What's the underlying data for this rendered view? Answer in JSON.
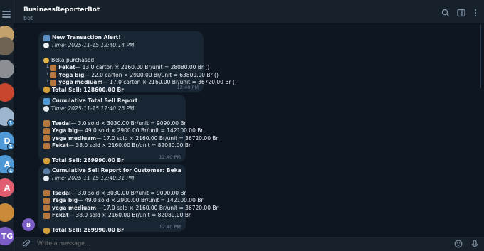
{
  "header": {
    "title": "BusinessReporterBot",
    "subtitle": "bot",
    "icons": [
      "search-icon",
      "sidebar-toggle-icon",
      "more-vert-icon"
    ]
  },
  "sidebar": {
    "chats": [
      {
        "initial": "",
        "color": "#c2a26a",
        "badge": ""
      },
      {
        "initial": "",
        "color": "#6e6252",
        "badge": ""
      },
      {
        "initial": "",
        "color": "#8b8f94",
        "badge": ""
      },
      {
        "initial": "",
        "color": "#c8462e",
        "badge": ""
      },
      {
        "initial": "",
        "color": "#9fb6cf",
        "badge": "1"
      },
      {
        "initial": "D",
        "color": "#4f9ad6",
        "badge": "1"
      },
      {
        "initial": "A",
        "color": "#4f9ad6",
        "badge": "1"
      },
      {
        "initial": "A",
        "color": "#e05d6f",
        "badge": ""
      },
      {
        "initial": "",
        "color": "#c98a3a",
        "badge": ""
      },
      {
        "initial": "TG",
        "color": "#7c5cc6",
        "badge": ""
      }
    ]
  },
  "messages": [
    {
      "title": "New Transaction Alert!",
      "time": "Time: 2025-11-15 12:40:14 PM",
      "buyer": "Beka purchased:",
      "items": [
        {
          "name": "Fekat",
          "text": " — 13.0 carton × 2160.00 Br/unit = 28080.00 Br ()"
        },
        {
          "name": "Yega big",
          "text": " — 22.0 carton × 2900.00 Br/unit = 63800.00 Br ()"
        },
        {
          "name": "yega mediuam",
          "text": " — 17.0 carton × 2160.00 Br/unit = 36720.00 Br ()"
        }
      ],
      "total": "Total Sell: 128600.00 Br",
      "stamp": "12:40 PM"
    },
    {
      "title": "Cumulative Total Sell Report",
      "time": "Time: 2025-11-15 12:40:26 PM",
      "items": [
        {
          "name": "Tsedal",
          "text": " — 3.0 sold × 3030.00 Br/unit = 9090.00 Br"
        },
        {
          "name": "Yega big",
          "text": " — 49.0 sold × 2900.00 Br/unit = 142100.00 Br"
        },
        {
          "name": "yega mediuam",
          "text": " — 17.0 sold × 2160.00 Br/unit = 36720.00 Br"
        },
        {
          "name": "Fekat",
          "text": " — 38.0 sold × 2160.00 Br/unit = 82080.00 Br"
        }
      ],
      "total": "Total Sell: 269990.00 Br",
      "stamp": "12:40 PM"
    },
    {
      "title": "Cumulative Sell Report for Customer: Beka",
      "time": "Time: 2025-11-15 12:40:31 PM",
      "items": [
        {
          "name": "Tsedal",
          "text": " — 3.0 sold × 3030.00 Br/unit = 9090.00 Br"
        },
        {
          "name": "Yega big",
          "text": " — 49.0 sold × 2900.00 Br/unit = 142100.00 Br"
        },
        {
          "name": "yega mediuam",
          "text": " — 17.0 sold × 2160.00 Br/unit = 36720.00 Br"
        },
        {
          "name": "Fekat",
          "text": " — 38.0 sold × 2160.00 Br/unit = 82080.00 Br"
        }
      ],
      "total": "Total Sell: 269990.00 Br",
      "stamp": "12:40 PM"
    }
  ],
  "bot_avatar": "B",
  "composer": {
    "placeholder": "Write a message..."
  },
  "colors": {
    "background": "#0e1621",
    "panel": "#17212b",
    "bubble": "#182533",
    "accent": "#4f9ad6"
  }
}
